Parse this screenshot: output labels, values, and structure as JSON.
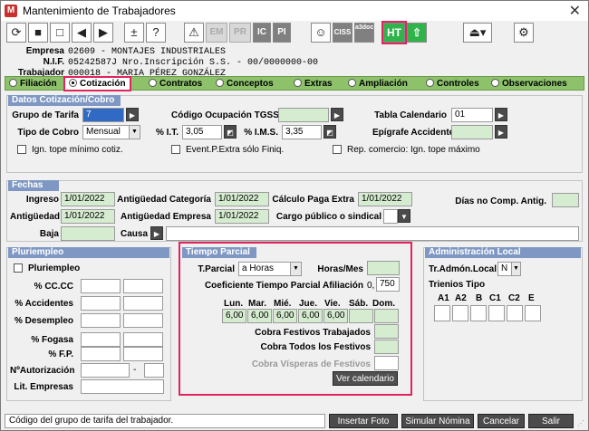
{
  "window": {
    "title": "Mantenimiento de Trabajadores",
    "app_icon_letter": "M"
  },
  "toolbar": {
    "em": "EM",
    "pr": "PR",
    "ic": "IC",
    "pi": "PI",
    "ciss": "CISS",
    "a3doc": "a3doc",
    "ht": "HT"
  },
  "header": {
    "empresa_label": "Empresa",
    "empresa_value": "02609  - MONTAJES INDUSTRIALES",
    "nif_label": "N.I.F.",
    "nif_value": "05242587J  Nro.Inscripción S.S. - 00/0000000-00",
    "trab_label": "Trabajador",
    "trab_value": "000018  - MARIA PÉREZ GONZÁLEZ"
  },
  "tabs": [
    "Filiación",
    "Cotización",
    "Contratos",
    "Conceptos",
    "Extras",
    "Ampliación",
    "Controles",
    "Observaciones"
  ],
  "cotizacion": {
    "title": "Datos Cotización/Cobro",
    "grupo_tarifa_label": "Grupo de Tarifa",
    "grupo_tarifa_value": "7",
    "codigo_tgss_label": "Código Ocupación TGSS",
    "tabla_calendario_label": "Tabla Calendario",
    "tabla_calendario_value": "01",
    "tipo_cobro_label": "Tipo de Cobro",
    "tipo_cobro_value": "Mensual",
    "it_label": "% I.T.",
    "it_value": "3,05",
    "ims_label": "% I.M.S.",
    "ims_value": "3,35",
    "epigrafe_label": "Epígrafe Accidentes",
    "ign_tope_label": "Ign. tope mínimo cotiz.",
    "event_label": "Event.P.Extra sólo Finiq.",
    "rep_label": "Rep. comercio: Ign. tope máximo"
  },
  "fechas": {
    "title": "Fechas",
    "ingreso_label": "Ingreso",
    "ingreso_value": "1/01/2022",
    "antig_cat_label": "Antigüedad Categoría",
    "antig_cat_value": "1/01/2022",
    "calc_paga_label": "Cálculo Paga Extra",
    "calc_paga_value": "1/01/2022",
    "dias_no_comp_label": "Días no Comp. Antig.",
    "antig_label": "Antigüedad",
    "antig_value": "1/01/2022",
    "antig_emp_label": "Antigüedad Empresa",
    "antig_emp_value": "1/01/2022",
    "cargo_label": "Cargo público o sindical",
    "baja_label": "Baja",
    "causa_label": "Causa"
  },
  "pluriempleo": {
    "title": "Pluriempleo",
    "check_label": "Pluriempleo",
    "rows": [
      "% CC.CC",
      "% Accidentes",
      "% Desempleo",
      "% Fogasa",
      "% F.P.",
      "NºAutorización",
      "Lit. Empresas"
    ]
  },
  "tiempo_parcial": {
    "title": "Tiempo Parcial",
    "tparcial_label": "T.Parcial",
    "tparcial_value": "a Horas",
    "horas_mes_label": "Horas/Mes",
    "coef_label": "Coeficiente Tiempo Parcial Afiliación",
    "coef_prefix": "0,",
    "coef_value": "750",
    "days": [
      "Lun.",
      "Mar.",
      "Mié.",
      "Jue.",
      "Vie.",
      "Sáb.",
      "Dom."
    ],
    "hours": [
      "6,00",
      "6,00",
      "6,00",
      "6,00",
      "6,00",
      "",
      ""
    ],
    "festivos_trab": "Cobra Festivos Trabajados",
    "todos_festivos": "Cobra Todos los Festivos",
    "visperas": "Cobra Vísperas de Festivos",
    "ver_calendario": "Ver calendario"
  },
  "admin_local": {
    "title": "Administración Local",
    "tr_label": "Tr.Admón.Local",
    "tr_value": "N",
    "trienios_label": "Trienios Tipo",
    "trienios": [
      "A1",
      "A2",
      "B",
      "C1",
      "C2",
      "E"
    ]
  },
  "status_text": "Código del grupo de tarifa del trabajador.",
  "buttons": {
    "foto": "Insertar Foto",
    "nomina": "Simular Nómina",
    "cancelar": "Cancelar",
    "salir": "Salir"
  }
}
